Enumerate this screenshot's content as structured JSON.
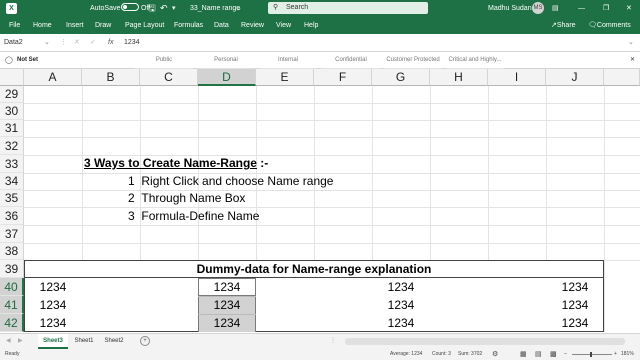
{
  "titlebar": {
    "autosave_label": "AutoSave",
    "autosave_state": "Off",
    "filename": "33_Name range",
    "search_placeholder": "Search",
    "user_name": "Madhu Sudan",
    "user_initials": "MS",
    "accent": "#1e7145"
  },
  "menu": {
    "items": [
      "File",
      "Home",
      "Insert",
      "Draw",
      "Page Layout",
      "Formulas",
      "Data",
      "Review",
      "View",
      "Help"
    ],
    "share": "Share",
    "comments": "Comments"
  },
  "formula_bar": {
    "name_box": "Data2",
    "fx": "fx",
    "value": "1234"
  },
  "sensitivity": {
    "current": "Not Set",
    "options": [
      "Public",
      "Personal",
      "Internal",
      "Confidential",
      "Customer Protected",
      "Critical and Highly..."
    ]
  },
  "columns": [
    "A",
    "B",
    "C",
    "D",
    "E",
    "F",
    "G",
    "H",
    "I",
    "J"
  ],
  "rows": [
    "29",
    "30",
    "31",
    "32",
    "33",
    "34",
    "35",
    "36",
    "37",
    "38",
    "39",
    "40",
    "41",
    "42"
  ],
  "content": {
    "heading": "3 Ways to Create Name-Range",
    "heading_suffix": " :-",
    "items": [
      {
        "num": "1",
        "text": "Right Click and choose Name range"
      },
      {
        "num": "2",
        "text": "Through Name Box"
      },
      {
        "num": "3",
        "text": "Formula-Define Name"
      }
    ],
    "table_title": "Dummy-data for Name-range explanation",
    "table_rows": [
      [
        "1234",
        "1234",
        "1234",
        "1234"
      ],
      [
        "1234",
        "1234",
        "1234",
        "1234"
      ],
      [
        "1234",
        "1234",
        "1234",
        "1234"
      ]
    ]
  },
  "sheets": {
    "tabs": [
      "Sheet3",
      "Sheet1",
      "Sheet2"
    ],
    "active": "Sheet3",
    "add": "+"
  },
  "status": {
    "ready": "Ready",
    "average": "Average: 1234",
    "count": "Count: 3",
    "sum": "Sum: 3702",
    "zoom": "181%"
  }
}
